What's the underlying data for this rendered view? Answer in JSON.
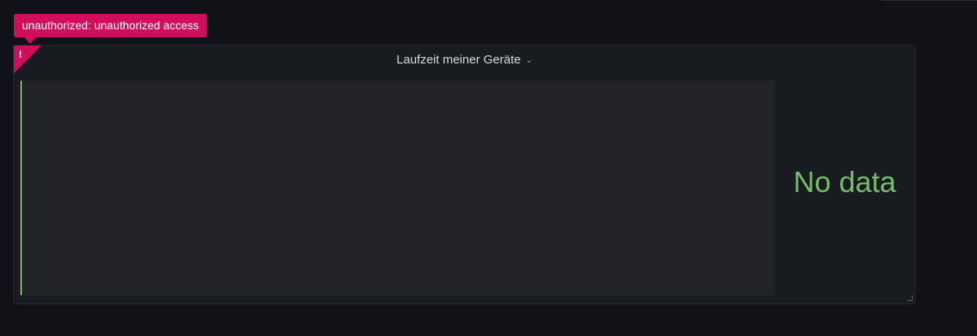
{
  "error_tooltip": {
    "message": "unauthorized: unauthorized access"
  },
  "panel": {
    "title": "Laufzeit meiner Geräte",
    "error_indicator": "!",
    "no_data_text": "No data",
    "icons": {
      "title_menu": "chevron-down-icon",
      "error": "exclamation-icon",
      "resize": "resize-handle-icon"
    }
  },
  "colors": {
    "background": "#111217",
    "panel_background": "#181b1f",
    "error": "#d10e5c",
    "series": "#73bf69"
  }
}
